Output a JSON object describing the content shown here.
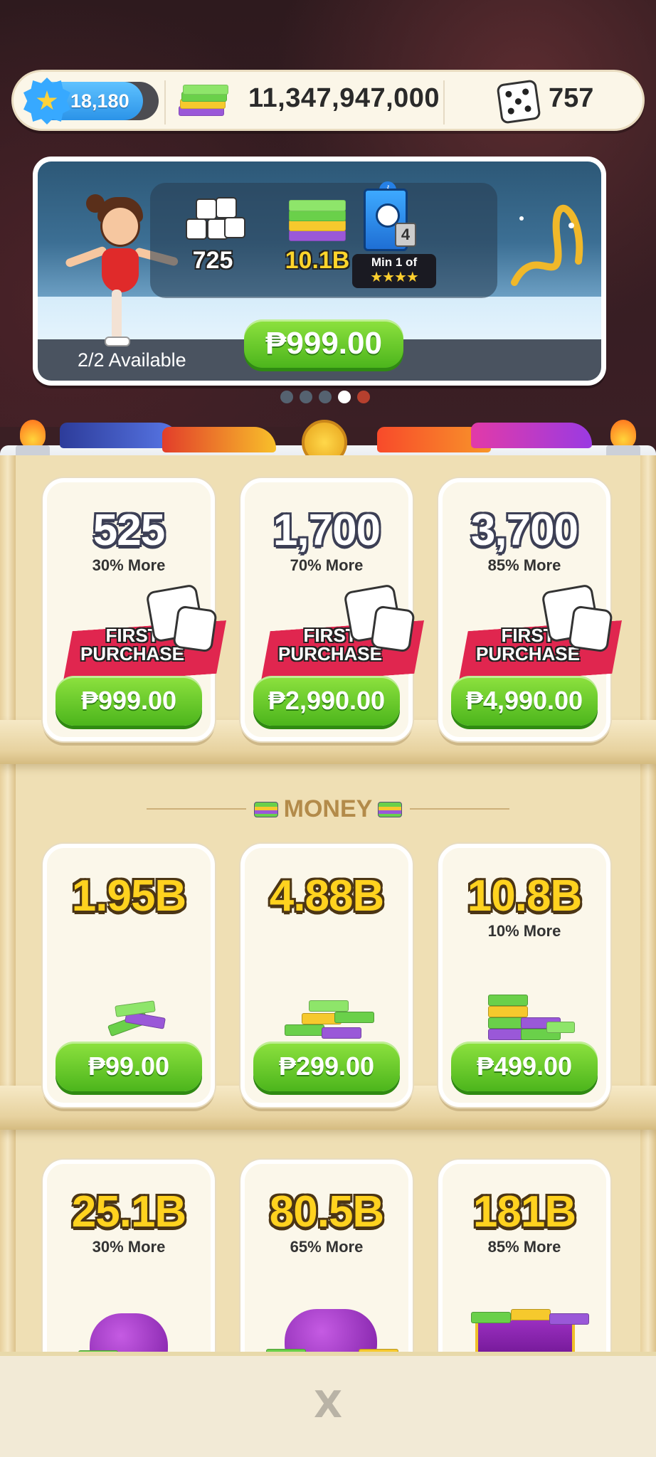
{
  "currency_bar": {
    "medal_value": "18,180",
    "cash_value": "11,347,947,000",
    "dice_value": "757"
  },
  "featured_offer": {
    "rewards": [
      {
        "qty": "725",
        "icon": "dice-icon"
      },
      {
        "qty": "10.1B",
        "icon": "cash-icon"
      },
      {
        "qty": "4",
        "icon": "sticker-pack-icon",
        "label": "Min 1 of",
        "stars": "★★★★"
      }
    ],
    "availability": "2/2 Available",
    "price": "₱999.00",
    "carousel": {
      "total": 5,
      "active_index": 3
    }
  },
  "dice_section": {
    "ribbon_text": [
      "FIRST",
      "PURCHASE"
    ],
    "cards": [
      {
        "amount": "525",
        "bonus": "30% More",
        "price": "₱999.00"
      },
      {
        "amount": "1,700",
        "bonus": "70% More",
        "price": "₱2,990.00"
      },
      {
        "amount": "3,700",
        "bonus": "85% More",
        "price": "₱4,990.00"
      }
    ]
  },
  "money_section": {
    "title": "MONEY",
    "cards": [
      {
        "amount": "1.95B",
        "bonus": "",
        "price": "₱99.00"
      },
      {
        "amount": "4.88B",
        "bonus": "",
        "price": "₱299.00"
      },
      {
        "amount": "10.8B",
        "bonus": "10% More",
        "price": "₱499.00"
      },
      {
        "amount": "25.1B",
        "bonus": "30% More",
        "price": ""
      },
      {
        "amount": "80.5B",
        "bonus": "65% More",
        "price": ""
      },
      {
        "amount": "181B",
        "bonus": "85% More",
        "price": ""
      }
    ]
  },
  "bottom_bar": {
    "close_label": "X"
  },
  "colors": {
    "price_green": "#5cc524",
    "ribbon_red": "#e0264f",
    "gold_text": "#ffd21f",
    "shop_bg": "#efdfb4"
  }
}
